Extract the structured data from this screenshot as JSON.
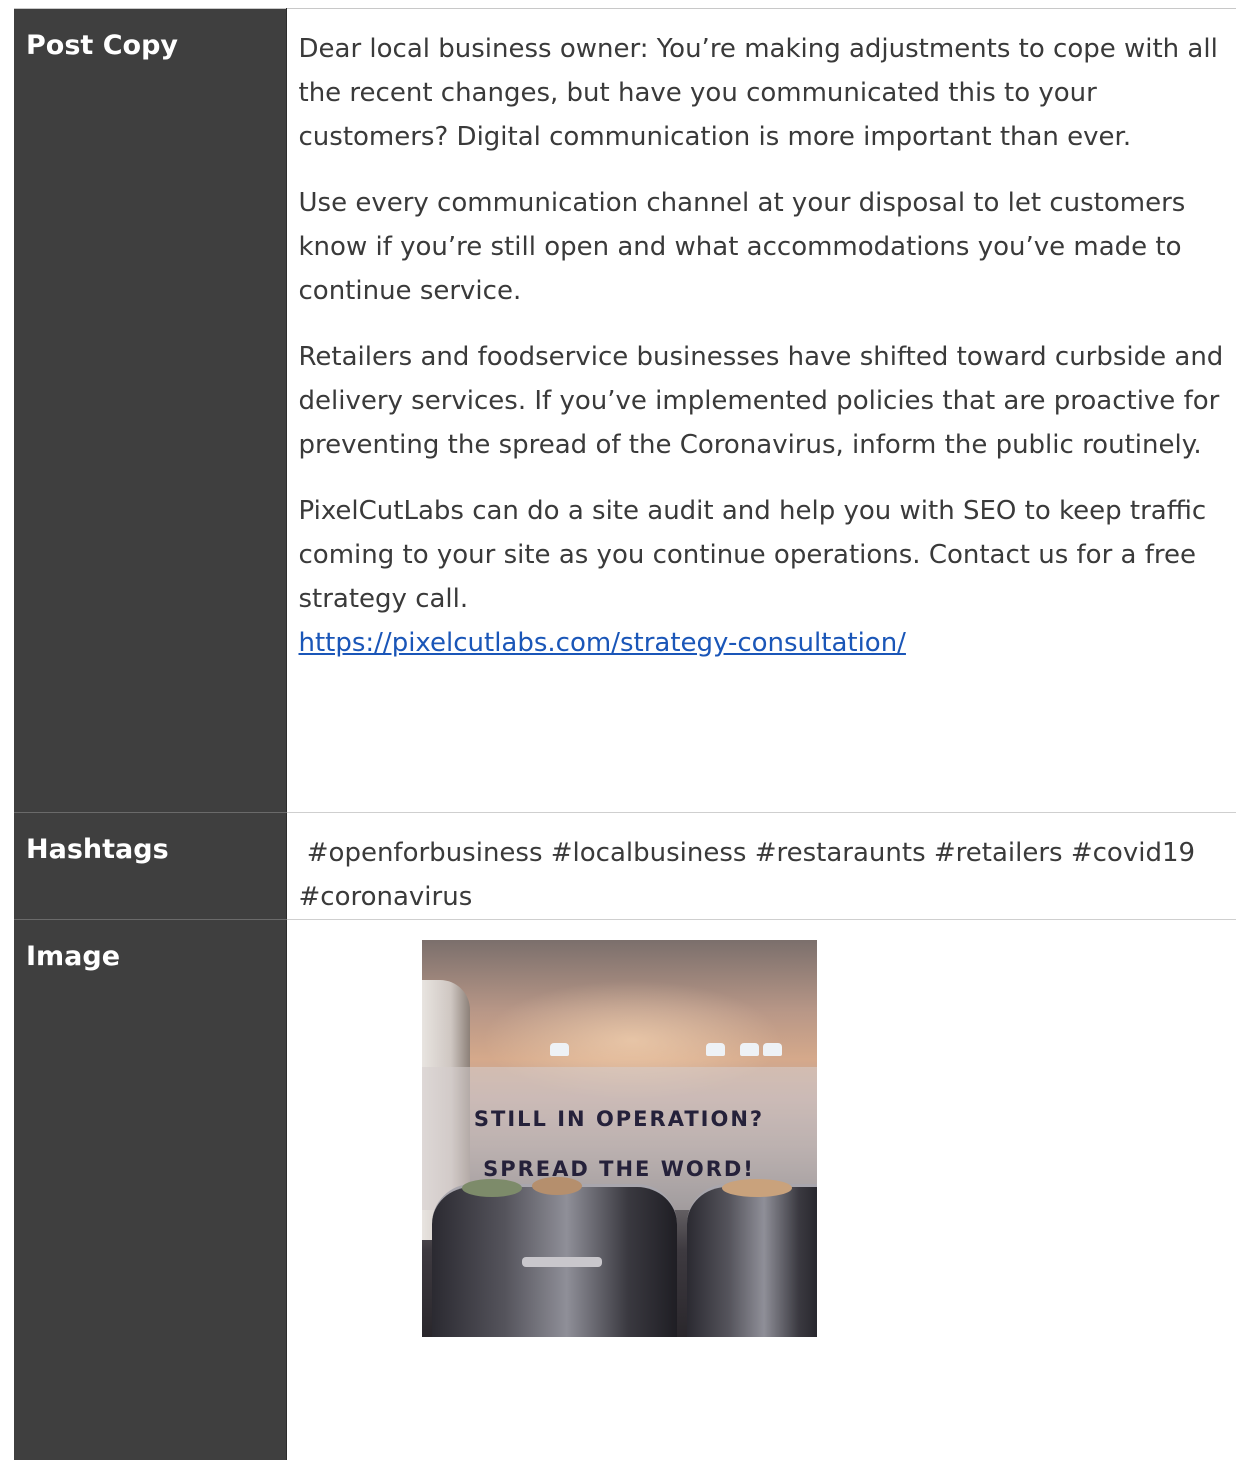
{
  "rows": {
    "post_copy": {
      "label": "Post Copy",
      "paragraphs": [
        "Dear local business owner: You’re making adjustments to cope with all the recent changes, but have you communicated this to your customers? Digital communication is more important than ever.",
        "Use every communication channel at your disposal to let customers know if you’re still open and what accommodations you’ve made to continue service.",
        "Retailers and foodservice businesses have shifted toward curbside and delivery services. If you’ve implemented policies that are proactive for preventing the spread of the Coronavirus, inform the public routinely.",
        "PixelCutLabs can do a site audit and help you with SEO to keep traffic coming to your site as you continue operations. Contact us for a free strategy call."
      ],
      "link": "https://pixelcutlabs.com/strategy-consultation/"
    },
    "hashtags": {
      "label": "Hashtags",
      "value": " #openforbusiness #localbusiness #restaraunts #retailers #covid19 #coronavirus"
    },
    "image": {
      "label": "Image",
      "headline_line1": "STILL IN OPERATION?",
      "headline_line2": "SPREAD THE WORD!"
    }
  },
  "colors": {
    "label_bg": "#3f3f3f",
    "link": "#1a56b8",
    "headline": "#25213a"
  }
}
